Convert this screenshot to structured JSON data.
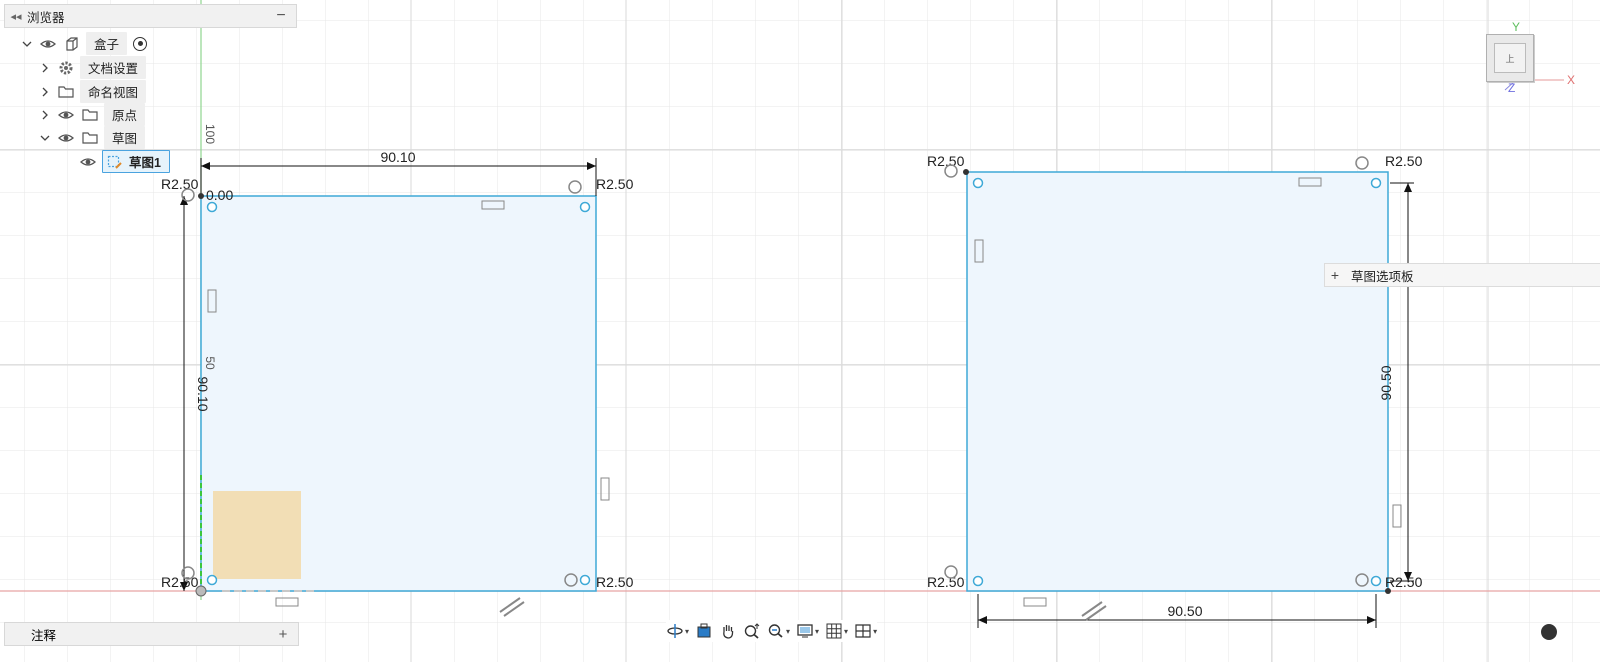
{
  "browser": {
    "title": "浏览器",
    "component": "盒子",
    "items": [
      {
        "label": "文档设置"
      },
      {
        "label": "命名视图"
      },
      {
        "label": "原点"
      },
      {
        "label": "草图"
      }
    ],
    "sketch": "草图1"
  },
  "annotations": {
    "title": "注释"
  },
  "palette": {
    "label": "草图选项板"
  },
  "viewcube": {
    "face": "上"
  },
  "axes": {
    "x": "X",
    "y": "Y",
    "z": "Z"
  },
  "colors": {
    "sketch_fill": "#eef6fd",
    "sketch_stroke": "#3ea9d7",
    "x_axis": "#e8a3a3",
    "y_axis": "#7ecf7e",
    "accent": "#4aa3df",
    "origin_plane": "#f2d9a8"
  },
  "sketch1": {
    "width_label": "90.10",
    "height_label": "90.10",
    "radii": [
      "R2.50",
      "R2.50",
      "R2.50",
      "R2.50"
    ],
    "extra_label": "0.00",
    "ruler_100": "100",
    "ruler_50": "50"
  },
  "sketch2": {
    "width_label": "90.50",
    "height_label": "90.50",
    "radii": [
      "R2.50",
      "R2.50",
      "R2.50",
      "R2.50"
    ]
  },
  "toolbar": {
    "icons": [
      "orbit-icon",
      "look-at-icon",
      "pan-icon",
      "zoom-icon",
      "fit-icon",
      "display-settings-icon",
      "grid-icon",
      "viewports-icon"
    ]
  }
}
